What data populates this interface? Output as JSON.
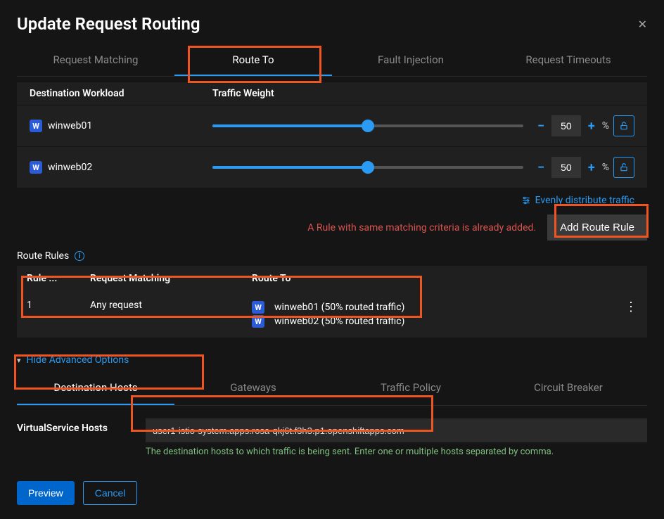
{
  "modal": {
    "title": "Update Request Routing"
  },
  "tabs": {
    "request_matching": "Request Matching",
    "route_to": "Route To",
    "fault_injection": "Fault Injection",
    "request_timeouts": "Request Timeouts"
  },
  "columns": {
    "destination_workload": "Destination Workload",
    "traffic_weight": "Traffic Weight"
  },
  "workloads": [
    {
      "name": "winweb01",
      "weight": "50"
    },
    {
      "name": "winweb02",
      "weight": "50"
    }
  ],
  "percent_symbol": "%",
  "evenly_distribute": "Evenly distribute traffic",
  "warning": "A Rule with same matching criteria is already added.",
  "add_route_rule": "Add Route Rule",
  "route_rules_label": "Route Rules",
  "rules_columns": {
    "order": "Rule ...",
    "request_matching": "Request Matching",
    "route_to": "Route To"
  },
  "rules": [
    {
      "order": "1",
      "matching": "Any request",
      "routes": [
        "winweb01 (50% routed traffic)",
        "winweb02 (50% routed traffic)"
      ]
    }
  ],
  "advanced": {
    "toggle": "Hide Advanced Options",
    "tabs": {
      "destination_hosts": "Destination Hosts",
      "gateways": "Gateways",
      "traffic_policy": "Traffic Policy",
      "circuit_breaker": "Circuit Breaker"
    },
    "vs_hosts_label": "VirtualService Hosts",
    "vs_hosts_value": "user1-istio-system.apps.rosa-qkj6t.f3h3.p1.openshiftapps.com",
    "vs_hosts_help": "The destination hosts to which traffic is being sent. Enter one or multiple hosts separated by comma."
  },
  "actions": {
    "preview": "Preview",
    "cancel": "Cancel"
  }
}
